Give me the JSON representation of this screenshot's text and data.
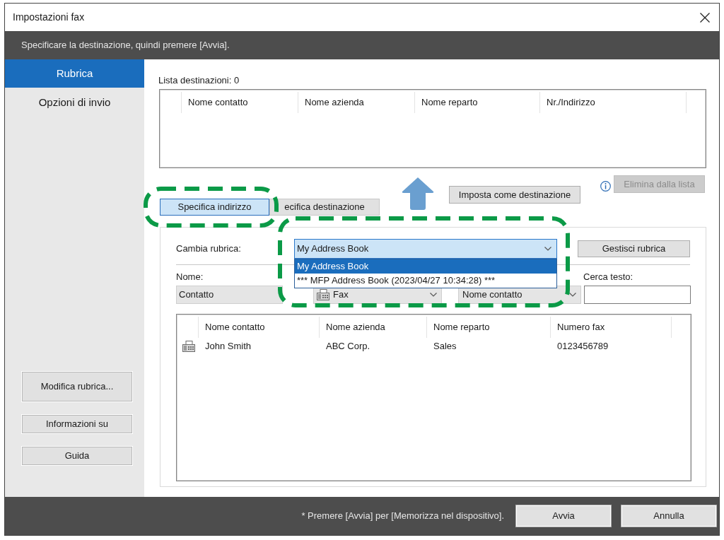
{
  "window": {
    "title": "Impostazioni fax"
  },
  "instruction_bar": {
    "text": "Specificare la destinazione, quindi premere [Avvia]."
  },
  "sidebar": {
    "items": [
      {
        "label": "Rubrica",
        "selected": true
      },
      {
        "label": "Opzioni di invio",
        "selected": false
      }
    ],
    "buttons": [
      "Modifica rubrica...",
      "Informazioni su",
      "Guida"
    ]
  },
  "destination_list": {
    "label": "Lista destinazioni: 0",
    "columns": [
      "Nome contatto",
      "Nome azienda",
      "Nome reparto",
      "Nr./Indirizzo"
    ]
  },
  "set_destination_button": {
    "label": "Imposta come destinazione"
  },
  "remove_button": {
    "label": "Elimina dalla lista",
    "disabled": true
  },
  "mode_tabs": [
    {
      "label": "Specifica indirizzo",
      "selected": true,
      "highlighted": true
    },
    {
      "label": "ecifica destinazione",
      "selected": false,
      "highlighted": false
    }
  ],
  "address_book": {
    "switch_label": "Cambia rubrica:",
    "selector": {
      "value": "My Address Book",
      "expanded": true,
      "highlighted": true,
      "options": [
        {
          "label": "My Address Book",
          "selected": true
        },
        {
          "label": "*** MFP Address Book (2023/04/27 10:34:28) ***",
          "selected": false
        }
      ]
    },
    "manage_button": {
      "label": "Gestisci rubrica"
    },
    "name_label": "Nome:",
    "name_field": {
      "value": "Contatto"
    },
    "type_field": {
      "value": "Fax"
    },
    "sort_field": {
      "value": "Nome contatto"
    },
    "search_label": "Cerca testo:",
    "table": {
      "columns": [
        "Nome contatto",
        "Nome azienda",
        "Nome reparto",
        "Numero fax"
      ],
      "rows": [
        {
          "cells": [
            "John Smith",
            "ABC Corp.",
            "Sales",
            "0123456789"
          ]
        }
      ]
    }
  },
  "footer": {
    "note": "* Premere [Avvia] per [Memorizza nel dispositivo].",
    "buttons": [
      "Avvia",
      "Annulla"
    ]
  }
}
